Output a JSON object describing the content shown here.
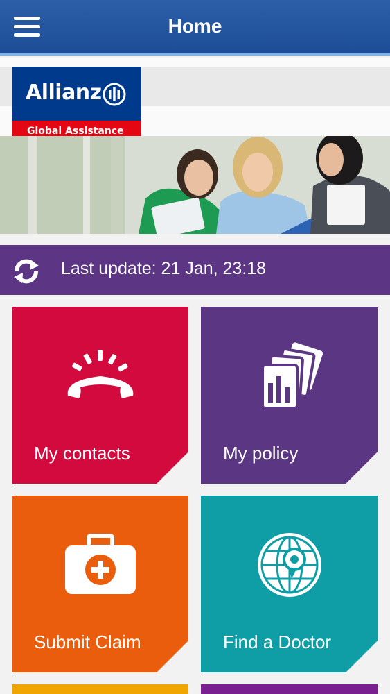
{
  "header": {
    "title": "Home"
  },
  "logo": {
    "brand": "Allianz",
    "subtitle": "Global Assistance"
  },
  "update": {
    "text": "Last update: 21 Jan, 23:18"
  },
  "tiles": [
    {
      "label": "My contacts",
      "color": "#d20a3e",
      "icon": "phone-icon"
    },
    {
      "label": "My policy",
      "color": "#5b3683",
      "icon": "policy-cards-icon"
    },
    {
      "label": "Submit Claim",
      "color": "#ea5d0c",
      "icon": "medical-kit-icon"
    },
    {
      "label": "Find a Doctor",
      "color": "#0f9ea6",
      "icon": "globe-pin-icon"
    }
  ],
  "colors": {
    "header": "#1d4d97",
    "update_bar": "#5c3584",
    "logo_blue": "#003a8c",
    "logo_red": "#e30613"
  }
}
